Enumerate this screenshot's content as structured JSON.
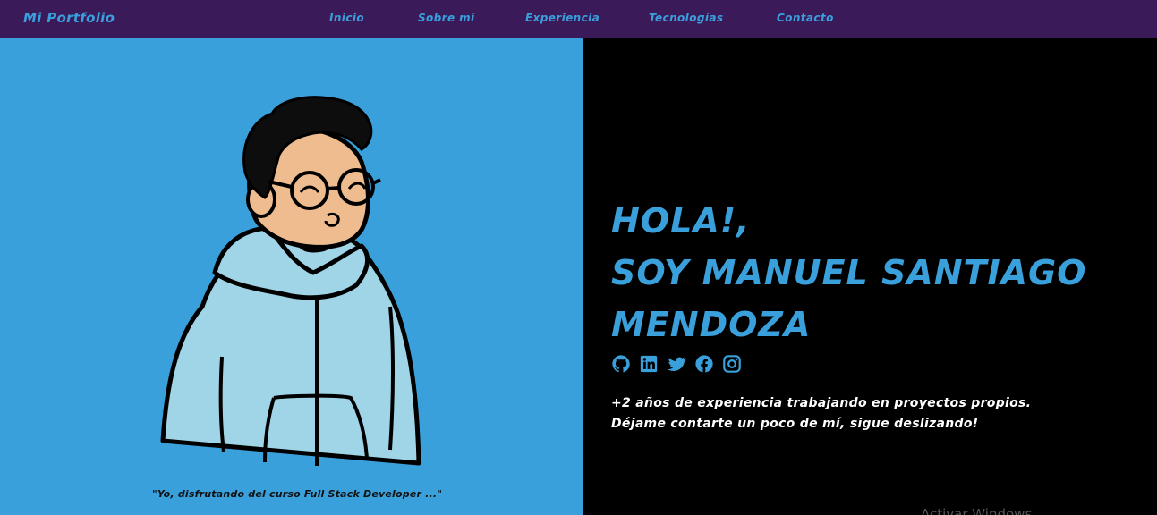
{
  "navbar": {
    "brand": "Mi Portfolio",
    "links": [
      "Inicio",
      "Sobre mí",
      "Experiencia",
      "Tecnologías",
      "Contacto"
    ]
  },
  "hero": {
    "illustration": "cartoon-avatar-hoodie-glasses",
    "caption": "\"Yo, disfrutando del curso Full Stack Developer ...\"",
    "title_lines": [
      "Hola!,",
      "soy Manuel Santiago",
      "Mendoza"
    ],
    "social_icons": [
      "github-icon",
      "linkedin-icon",
      "twitter-icon",
      "facebook-icon",
      "instagram-icon"
    ],
    "description_lines": [
      "+2 años de experiencia trabajando en proyectos propios.",
      "Déjame contarte un poco de mí, sigue deslizando!"
    ],
    "watermark": "Activar Windows"
  },
  "colors": {
    "navbar_bg": "#3b1a5a",
    "accent_blue": "#3aa0db",
    "hero_left_bg": "#3aa0db",
    "hero_right_bg": "#000000",
    "text_white": "#ffffff"
  }
}
